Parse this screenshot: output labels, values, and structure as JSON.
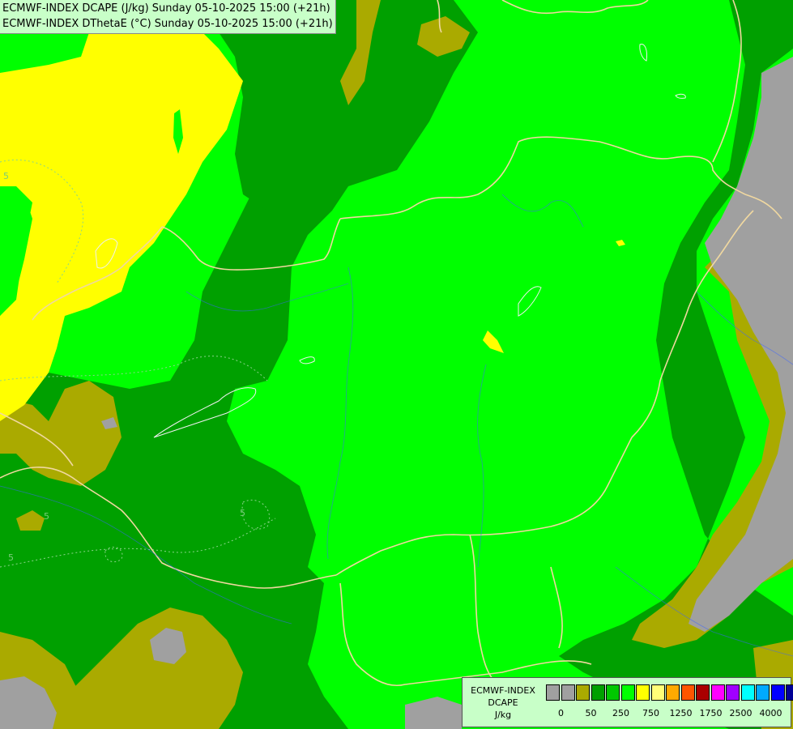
{
  "header": {
    "line1": "ECMWF-INDEX DCAPE (J/kg) Sunday 05-10-2025 15:00 (+21h)",
    "line2": "ECMWF-INDEX DThetaE (°C) Sunday 05-10-2025 15:00 (+21h)"
  },
  "contour_labels": [
    "5",
    "5",
    "5",
    "5"
  ],
  "colors": {
    "nodata": "#a0a0a0",
    "olive": "#aaaa00",
    "dark_green": "#00a000",
    "light_green": "#00ff00",
    "yellow": "#ffff00",
    "border_line": "#f0d8a0",
    "river_line": "#3c64ff"
  },
  "legend": {
    "line1": "ECMWF-INDEX",
    "line2": "DCAPE",
    "line3": "J/kg",
    "swatches": [
      "#a0a0a0",
      "#a0a0a0",
      "#aaaa00",
      "#00a000",
      "#00c800",
      "#00ff00",
      "#ffff00",
      "#ffff78",
      "#ffaa00",
      "#ff5500",
      "#aa0000",
      "#ff00ff",
      "#a000ff",
      "#00ffff",
      "#00aaff",
      "#0000ff",
      "#000096"
    ],
    "ticks": [
      "0",
      "50",
      "250",
      "750",
      "1250",
      "1750",
      "2500",
      "4000"
    ]
  }
}
